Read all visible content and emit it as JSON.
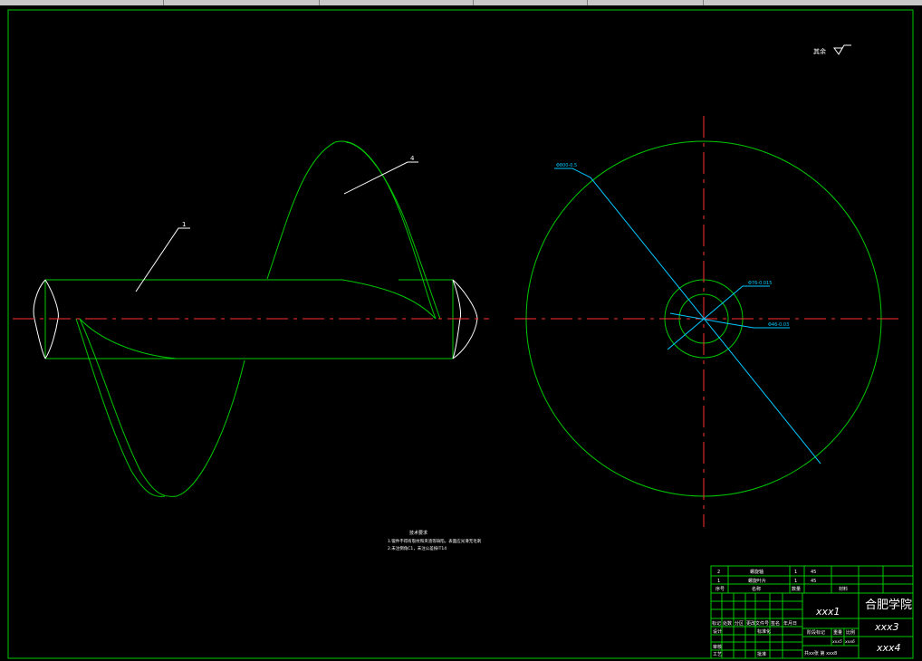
{
  "drawing": {
    "part_labels": [
      "1",
      "4"
    ],
    "surface_finish": "其余",
    "dimensions": [
      "Φ800-0.5",
      "Φ76-0.015",
      "Φ46-0.03"
    ],
    "notes": {
      "title": "技术要求",
      "line1": "1.锻件不得有裂纹和夹渣等缺陷，表面应光滑无毛刺",
      "line2": "2.未注倒角C1，未注公差按IT14"
    }
  },
  "title_block": {
    "parts": [
      {
        "seq": "2",
        "name": "螺旋轴",
        "qty": "1",
        "material": "45"
      },
      {
        "seq": "1",
        "name": "螺旋叶片",
        "qty": "1",
        "material": "45"
      }
    ],
    "header": {
      "seq": "序号",
      "name": "名称",
      "qty": "数量",
      "material": "材料"
    },
    "drawing_name": "xxx1",
    "school": "合肥学院",
    "drawing_number": "xxx3",
    "extra": "xxx4",
    "rev_cols": [
      "标记",
      "处数",
      "分区",
      "更改文件号",
      "签名",
      "年月日"
    ],
    "roles": {
      "design": "设计",
      "standard": "标准化",
      "check": "审核",
      "process": "工艺",
      "approve": "批准"
    },
    "stage": {
      "stage_mark": "阶段标记",
      "weight": "重量",
      "scale": "比例",
      "weight_val": "xxx5",
      "scale_val": "xxx6"
    },
    "sheets": "共xx张 第 xxx8"
  }
}
